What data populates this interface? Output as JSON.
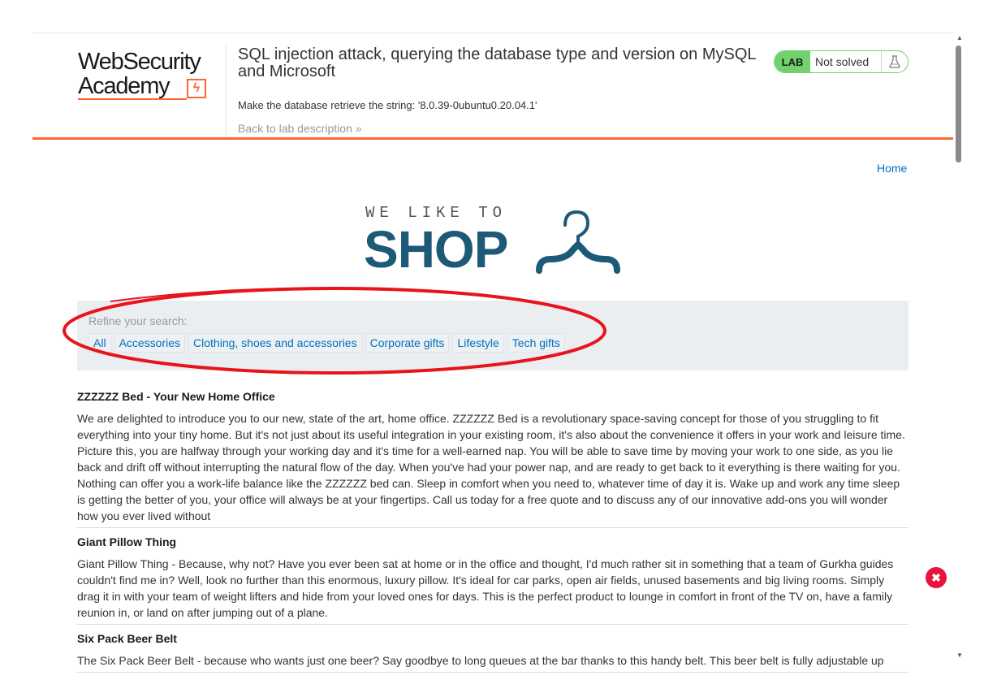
{
  "academy_header": {
    "logo_line1": "WebSecurity",
    "logo_line2": "Academy",
    "logo_bolt": "ϟ",
    "lab_title": "SQL injection attack, querying the database type and version on MySQL and Microsoft",
    "lab_subtitle": "Make the database retrieve the string: '8.0.39-0ubuntu0.20.04.1'",
    "back_link": "Back to lab description",
    "back_chevron": "»",
    "status": {
      "badge": "LAB",
      "text": "Not solved",
      "icon": "flask-icon"
    }
  },
  "nav": {
    "home": "Home"
  },
  "shop_logo": {
    "tagline": "WE LIKE TO",
    "word": "SHOP"
  },
  "filters": {
    "label": "Refine your search:",
    "items": [
      "All",
      "Accessories",
      "Clothing, shoes and accessories",
      "Corporate gifts",
      "Lifestyle",
      "Tech gifts"
    ]
  },
  "products": [
    {
      "title": "ZZZZZZ Bed - Your New Home Office",
      "description": "We are delighted to introduce you to our new, state of the art, home office. ZZZZZZ Bed is a revolutionary space-saving concept for those of you struggling to fit everything into your tiny home. But it's not just about its useful integration in your existing room, it's also about the convenience it offers in your work and leisure time. Picture this, you are halfway through your working day and it's time for a well-earned nap. You will be able to save time by moving your work to one side, as you lie back and drift off without interrupting the natural flow of the day. When you've had your power nap, and are ready to get back to it everything is there waiting for you. Nothing can offer you a work-life balance like the ZZZZZZ bed can. Sleep in comfort when you need to, whatever time of day it is. Wake up and work any time sleep is getting the better of you, your office will always be at your fingertips. Call us today for a free quote and to discuss any of our innovative add-ons you will wonder how you ever lived without"
    },
    {
      "title": "Giant Pillow Thing",
      "description": "Giant Pillow Thing - Because, why not? Have you ever been sat at home or in the office and thought, I'd much rather sit in something that a team of Gurkha guides couldn't find me in? Well, look no further than this enormous, luxury pillow. It's ideal for car parks, open air fields, unused basements and big living rooms. Simply drag it in with your team of weight lifters and hide from your loved ones for days. This is the perfect product to lounge in comfort in front of the TV on, have a family reunion in, or land on after jumping out of a plane."
    },
    {
      "title": "Six Pack Beer Belt",
      "description": "The Six Pack Beer Belt - because who wants just one beer? Say goodbye to long queues at the bar thanks to this handy belt. This beer belt is fully adjustable up"
    }
  ],
  "floating_badge": {
    "icon": "close-icon",
    "glyph": "✖"
  },
  "colors": {
    "accent": "#ff6633",
    "link": "#0071bc",
    "status_green": "#70d16d",
    "shop_blue": "#1d5a77",
    "annotation_red": "#e8141c"
  }
}
